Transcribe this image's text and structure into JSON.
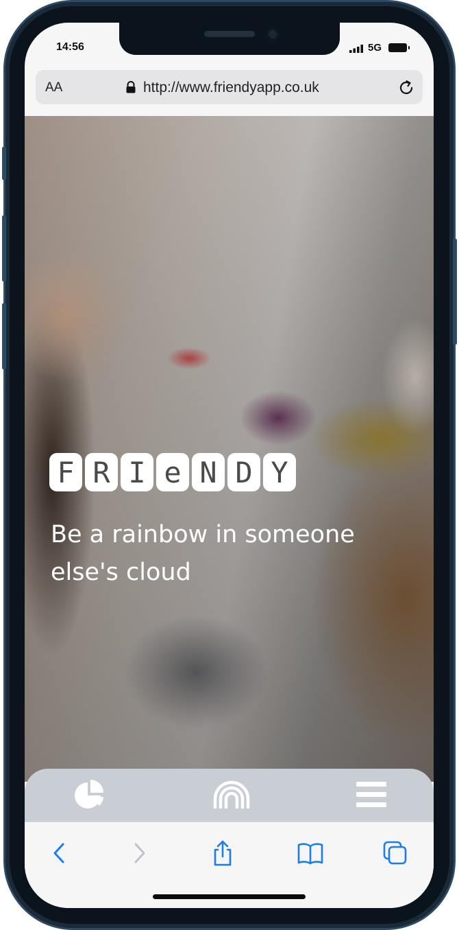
{
  "status_bar": {
    "time": "14:56",
    "network": "5G"
  },
  "browser": {
    "text_size_label": "AA",
    "url": "http://www.friendyapp.co.uk"
  },
  "hero": {
    "logo_letters": [
      "F",
      "R",
      "I",
      "e",
      "N",
      "D",
      "Y"
    ],
    "tagline": "Be a rainbow in someone else's cloud"
  },
  "app_nav": {
    "icons": [
      "pie-chart-icon",
      "rainbow-icon",
      "hamburger-menu-icon"
    ]
  },
  "safari_toolbar": {
    "icons": [
      "back-icon",
      "forward-icon",
      "share-icon",
      "bookmarks-icon",
      "tabs-icon"
    ]
  },
  "colors": {
    "accent": "#1a7cf0",
    "nav_background": "#c9cdd4",
    "device_frame": "#2d4a63"
  }
}
